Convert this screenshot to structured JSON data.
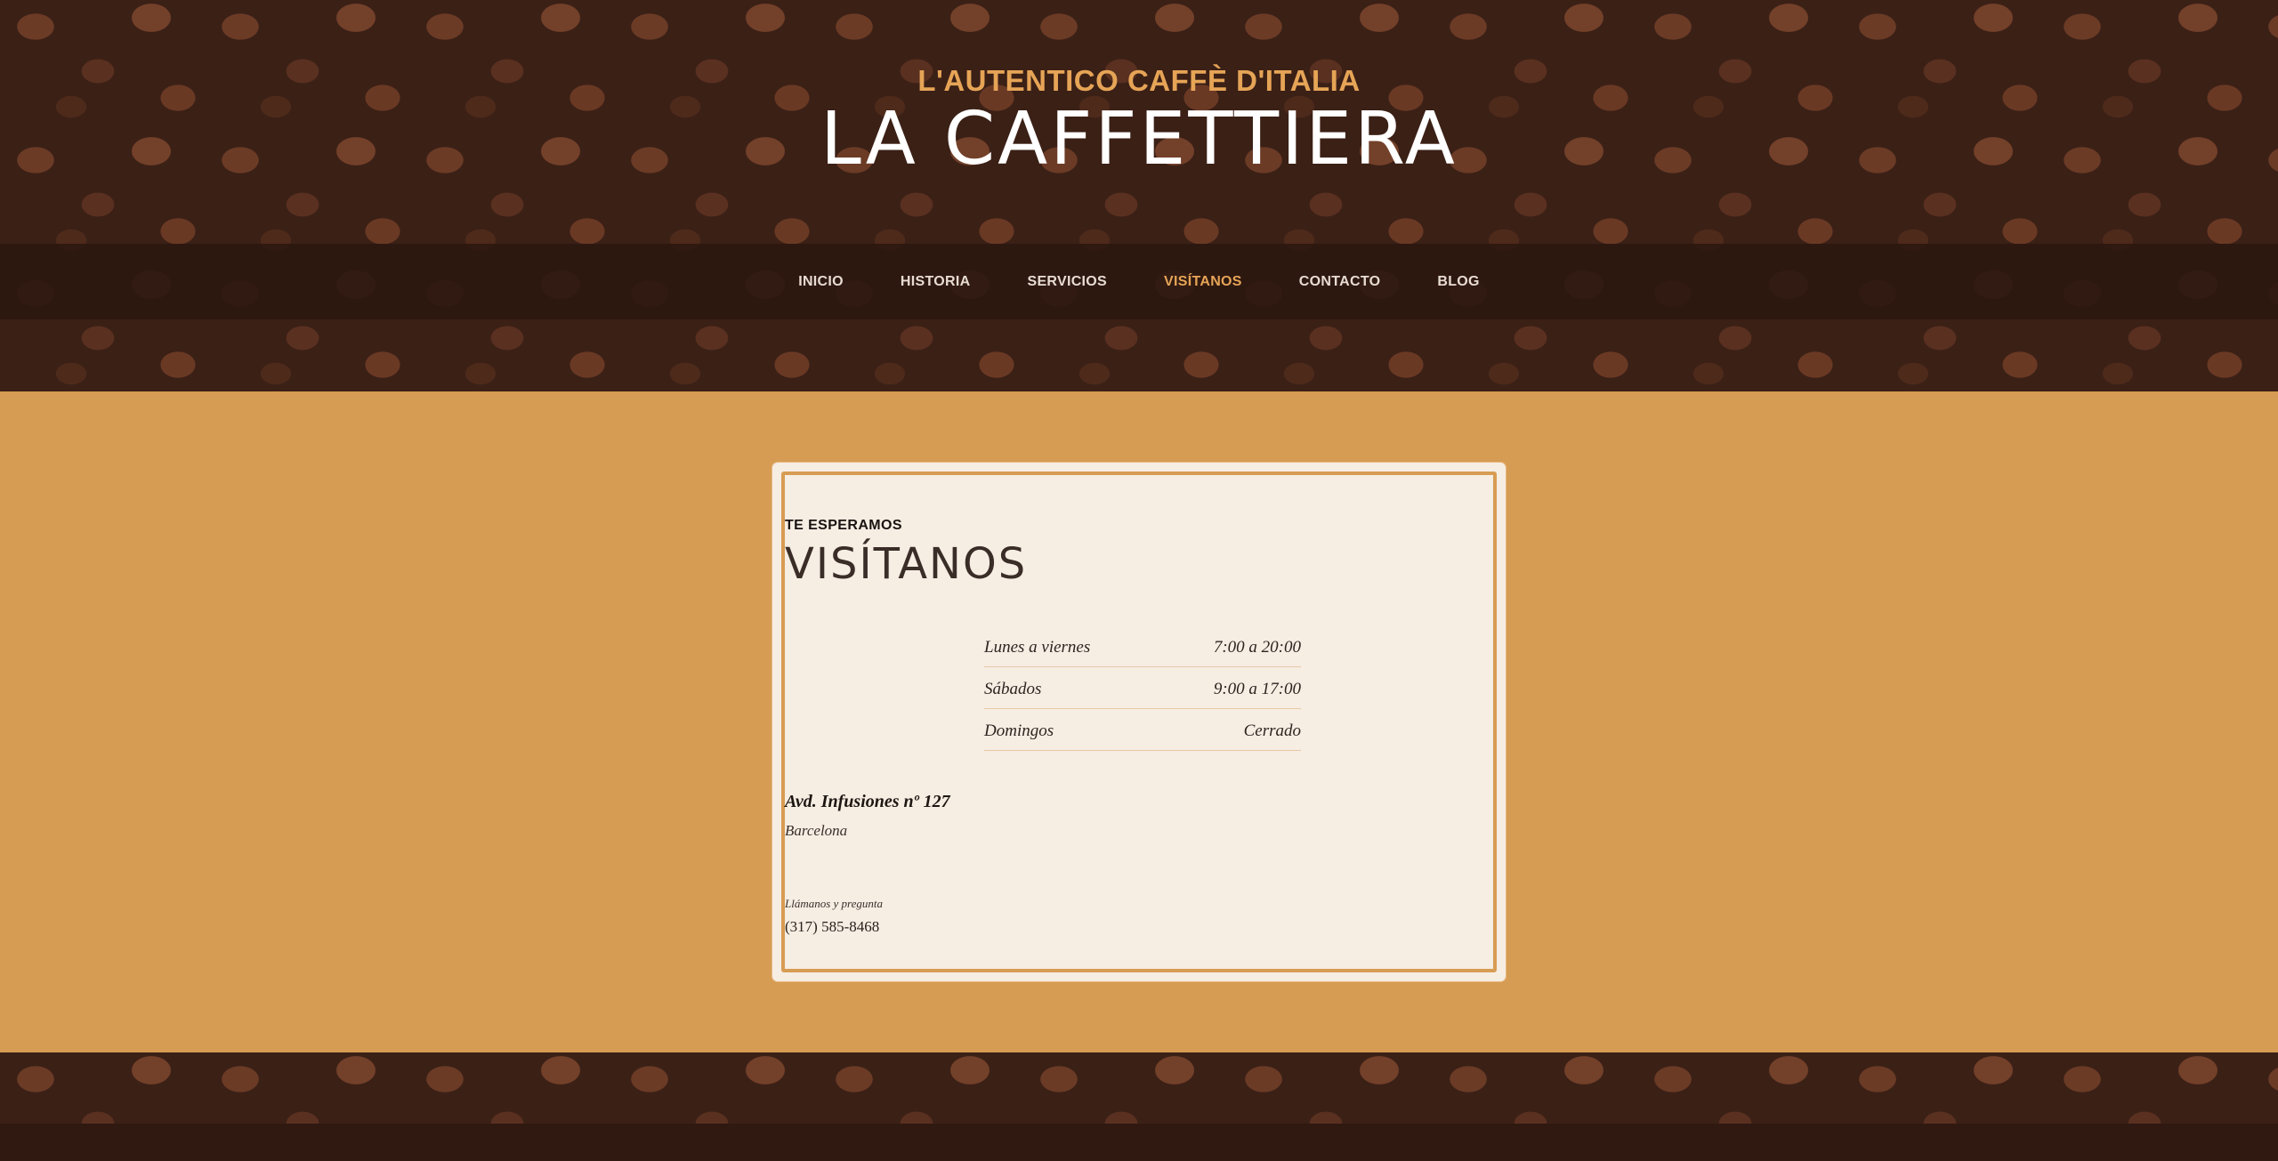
{
  "header": {
    "tagline": "L'AUTENTICO CAFFÈ D'ITALIA",
    "title": "LA CAFFETTIERA"
  },
  "nav": {
    "items": [
      {
        "label": "INICIO"
      },
      {
        "label": "HISTORIA"
      },
      {
        "label": "SERVICIOS"
      },
      {
        "label": "VISÍTANOS"
      },
      {
        "label": "CONTACTO"
      },
      {
        "label": "BLOG"
      }
    ]
  },
  "visit": {
    "eyebrow": "TE ESPERAMOS",
    "title": "VISÍTANOS",
    "hours": [
      {
        "day": "Lunes a viernes",
        "time": "7:00 a 20:00"
      },
      {
        "day": "Sábados",
        "time": "9:00 a 17:00"
      },
      {
        "day": "Domingos",
        "time": "Cerrado"
      }
    ],
    "address": "Avd. Infusiones nº 127",
    "city": "Barcelona",
    "call_label": "Llámanos y pregunta",
    "phone": "(317) 585-8468"
  },
  "colors": {
    "accent": "#e6a456",
    "section_bg": "#d79c53",
    "card_bg": "#f6ede3",
    "nav_bg": "#2d1810"
  }
}
